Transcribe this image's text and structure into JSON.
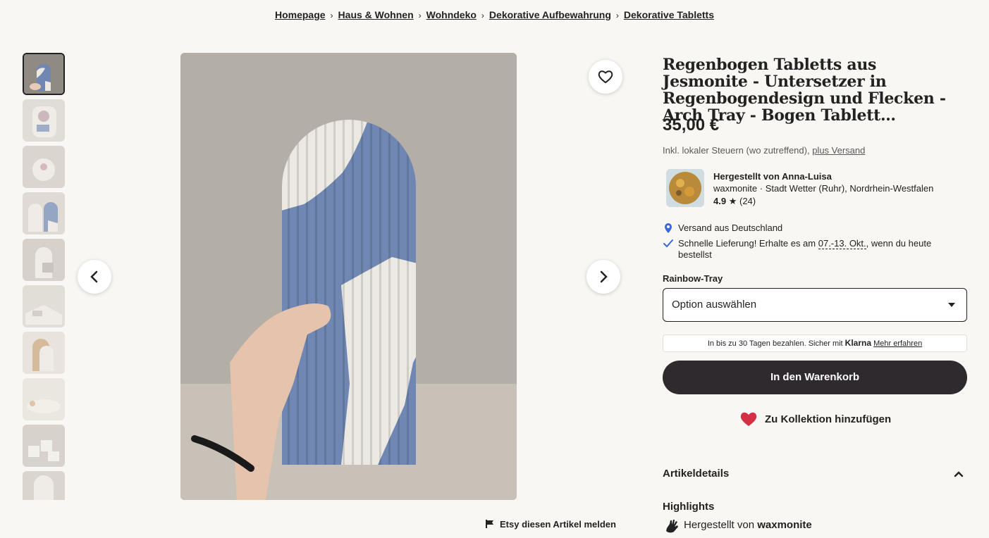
{
  "breadcrumb": [
    {
      "label": "Homepage"
    },
    {
      "label": "Haus & Wohnen"
    },
    {
      "label": "Wohndeko"
    },
    {
      "label": "Dekorative Aufbewahrung"
    },
    {
      "label": "Dekorative Tabletts"
    }
  ],
  "product": {
    "title": "Regenbogen Tabletts aus Jesmonite - Untersetzer in Regenbogendesign und Flecken - Arch Tray - Bogen Tablett…",
    "price": "35,00 €",
    "tax_text": "Inkl. lokaler Steuern (wo zutreffend), ",
    "tax_link": "plus Versand"
  },
  "seller": {
    "made_by": "Hergestellt von Anna-Luisa",
    "location": "waxmonite · Stadt Wetter (Ruhr), Nordrhein-Westfalen",
    "rating": "4.9",
    "star": "★",
    "reviews": "(24)"
  },
  "shipping": {
    "origin": "Versand aus Deutschland",
    "fast_pre": "Schnelle Lieferung! Erhalte es am ",
    "fast_date": "07.-13. Okt.",
    "fast_post": ", wenn du heute bestellst"
  },
  "variant": {
    "label": "Rainbow-Tray",
    "placeholder": "Option auswählen"
  },
  "klarna": {
    "text": "In bis zu 30 Tagen bezahlen. Sicher mit ",
    "brand": "Klarna",
    "link": "Mehr erfahren"
  },
  "actions": {
    "cart": "In den Warenkorb",
    "collection": "Zu Kollektion hinzufügen",
    "report": "Etsy diesen Artikel melden"
  },
  "details": {
    "heading": "Artikeldetails",
    "highlights": "Highlights",
    "made_by_pre": "Hergestellt von ",
    "made_by_shop": "waxmonite"
  },
  "icons": [
    "heart-icon",
    "chevron-left-icon",
    "chevron-right-icon",
    "location-pin-icon",
    "checkmark-icon",
    "caret-down-icon",
    "flag-icon",
    "hand-icon",
    "chevron-up-icon"
  ],
  "colors": {
    "cart_button": "#2f2a2e",
    "heart_red": "#d32f45",
    "pin_blue": "#3b67d8",
    "tray_blue": "#6f87b2",
    "tray_white": "#ece9e3"
  },
  "gallery": {
    "thumbnail_count": 10,
    "active_index": 0
  }
}
